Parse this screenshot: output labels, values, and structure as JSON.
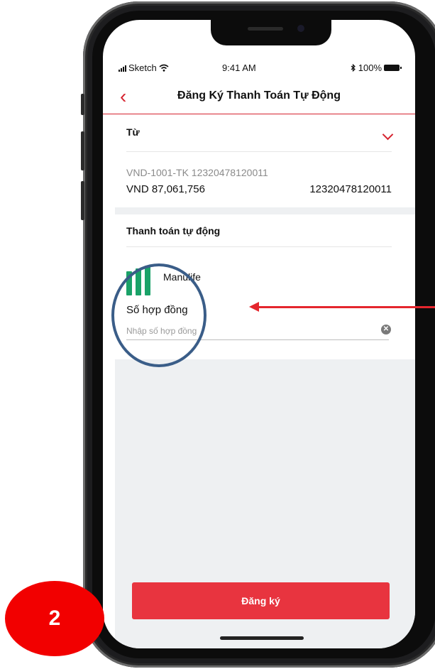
{
  "status_bar": {
    "carrier": "Sketch",
    "time": "9:41 AM",
    "bluetooth_icon": "bluetooth-icon",
    "battery": "100%"
  },
  "nav": {
    "back_icon": "chevron-left-icon",
    "title": "Đăng Ký Thanh Toán Tự Động"
  },
  "from_section": {
    "label": "Từ",
    "account_id": "VND-1001-TK 12320478120011",
    "balance": "VND 87,061,756",
    "account_number": "12320478120011"
  },
  "auto_payment": {
    "section_title": "Thanh toán tự động",
    "provider": "Manulife",
    "field_label": "Số hợp đồng",
    "field_placeholder": "Nhập số hợp đồng",
    "field_value": ""
  },
  "submit_label": "Đăng ký",
  "annotation": {
    "step_number": "2"
  },
  "colors": {
    "accent_red": "#d6232f",
    "button_red": "#e8343f",
    "manulife_green": "#1aa268",
    "annotation_circle": "#3a5d88",
    "badge_red": "#f20000"
  }
}
